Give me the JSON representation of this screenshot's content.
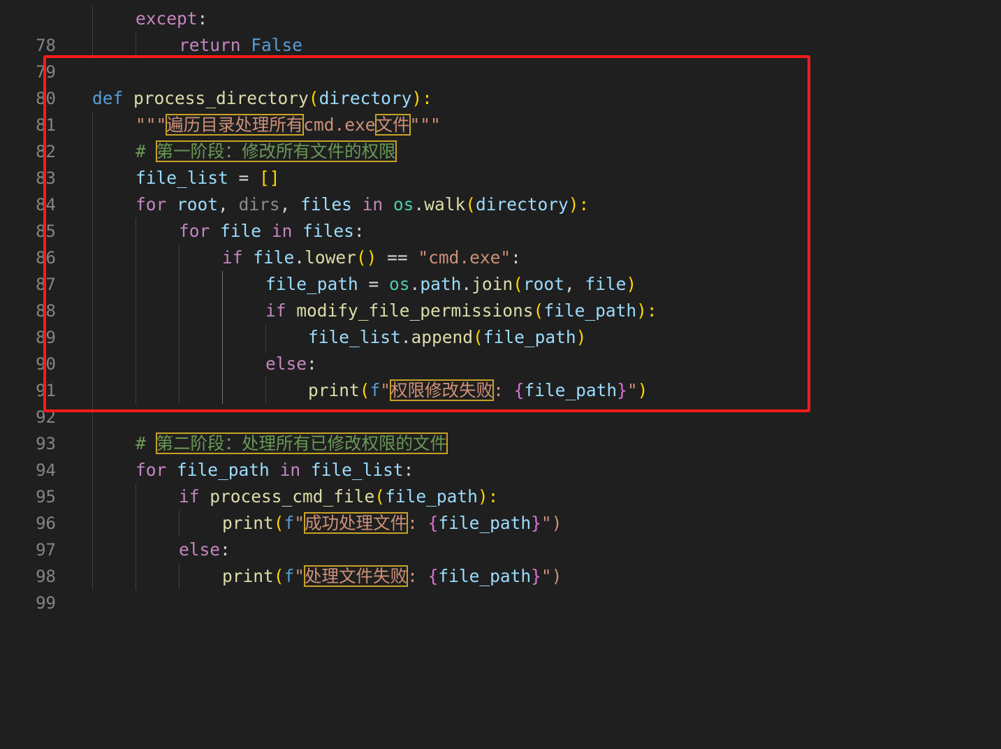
{
  "editor": {
    "lines": [
      {
        "n": "78",
        "t": [
          "except",
          ":"
        ]
      },
      {
        "n": "79",
        "t": [
          "return",
          "False"
        ]
      },
      {
        "n": "80"
      },
      {
        "n": "81",
        "t": [
          "def",
          "process_directory",
          "(",
          "directory",
          "):"
        ]
      },
      {
        "n": "82",
        "t": [
          "\"\"\"",
          "遍历目录处理所有",
          "cmd.exe",
          "文件",
          "\"\"\""
        ]
      },
      {
        "n": "83",
        "t": [
          "#",
          "第一阶段：修改所有文件的权限"
        ]
      },
      {
        "n": "84",
        "t": [
          "file_list",
          " = ",
          "[",
          "]"
        ]
      },
      {
        "n": "85",
        "t": [
          "for",
          "root",
          ", ",
          "dirs",
          ", ",
          "files",
          "in",
          "os",
          ".",
          "walk",
          "(",
          "directory",
          "):"
        ]
      },
      {
        "n": "86",
        "t": [
          "for",
          "file",
          "in",
          "files",
          ":"
        ]
      },
      {
        "n": "87",
        "t": [
          "if",
          "file",
          ".",
          "lower",
          "(",
          ")",
          " == ",
          "\"cmd.exe\"",
          ":"
        ]
      },
      {
        "n": "88",
        "t": [
          "file_path",
          " = ",
          "os",
          ".",
          "path",
          ".",
          "join",
          "(",
          "root",
          ", ",
          "file",
          ")"
        ]
      },
      {
        "n": "89",
        "t": [
          "if",
          "modify_file_permissions",
          "(",
          "file_path",
          "):"
        ]
      },
      {
        "n": "90",
        "t": [
          "file_list",
          ".",
          "append",
          "(",
          "file_path",
          ")"
        ]
      },
      {
        "n": "91",
        "t": [
          "else",
          ":"
        ]
      },
      {
        "n": "92",
        "t": [
          "print",
          "(",
          "f",
          "\"",
          "权限修改失败",
          ": ",
          "{",
          "file_path",
          "}",
          "\"",
          ")"
        ]
      },
      {
        "n": "93"
      },
      {
        "n": "94",
        "t": [
          "#",
          "第二阶段：处理所有已修改权限的文件"
        ]
      },
      {
        "n": "95",
        "t": [
          "for",
          "file_path",
          "in",
          "file_list",
          ":"
        ]
      },
      {
        "n": "96",
        "t": [
          "if",
          "process_cmd_file",
          "(",
          "file_path",
          "):"
        ]
      },
      {
        "n": "97",
        "t": [
          "print",
          "(",
          "f",
          "\"",
          "成功处理文件",
          ": ",
          "{",
          "file_path",
          "}",
          "\")"
        ]
      },
      {
        "n": "98",
        "t": [
          "else",
          ":"
        ]
      },
      {
        "n": "99",
        "t": [
          "print",
          "(",
          "f",
          "\"",
          "处理文件失败",
          ": ",
          "{",
          "file_path",
          "}",
          "\")"
        ]
      }
    ]
  },
  "colors": {
    "background": "#1f1f1f",
    "highlight_frame": "#ff1a1a",
    "find_match_border": "#c9a227"
  }
}
